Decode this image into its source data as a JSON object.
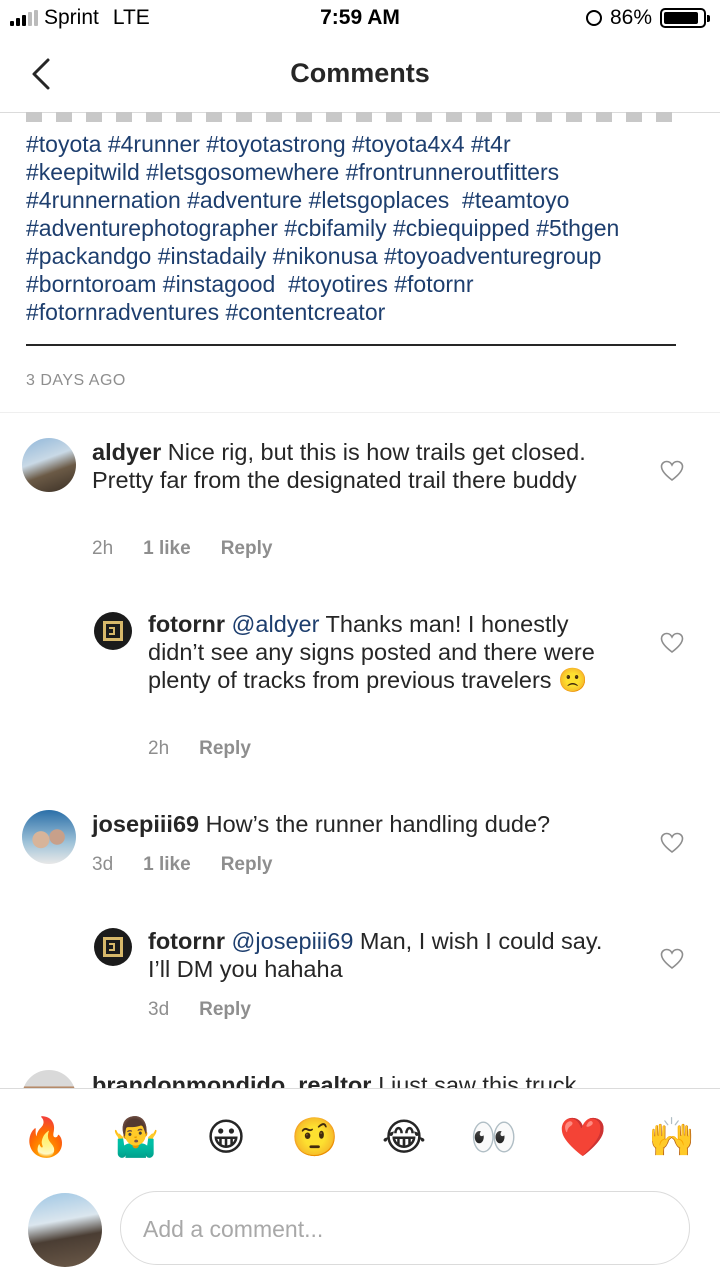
{
  "status_bar": {
    "carrier": "Sprint",
    "network": "LTE",
    "time": "7:59 AM",
    "battery": "86%"
  },
  "header": {
    "title": "Comments"
  },
  "caption": {
    "hashtags": "#toyota #4runner #toyotastrong #toyota4x4 #t4r\n#keepitwild #letsgosomewhere #frontrunneroutfitters\n#4runnernation #adventure #letsgoplaces  #teamtoyo\n#adventurephotographer #cbifamily #cbiequipped #5thgen\n#packandgo #instadaily #nikonusa #toyoadventuregroup\n#borntoroam #instagood  #toyotires #fotornr\n#fotornradventures #contentcreator",
    "posted": "3 DAYS AGO"
  },
  "comments": [
    {
      "user": "aldyer",
      "text": "Nice rig, but this is how trails get closed. Pretty far from the designated trail there buddy",
      "time": "2h",
      "likes": "1 like",
      "reply": "Reply"
    },
    {
      "user": "fotornr",
      "mention": "@aldyer",
      "text": "Thanks man! I honestly didn’t see any signs posted and there were plenty of tracks from previous travelers 🙁",
      "time": "2h",
      "reply": "Reply"
    },
    {
      "user": "josepiii69",
      "text": "How’s the runner handling dude?",
      "time": "3d",
      "likes": "1 like",
      "reply": "Reply"
    },
    {
      "user": "fotornr",
      "mention": "@josepiii69",
      "text": "Man, I wish I could say. I’ll DM you hahaha",
      "time": "3d",
      "reply": "Reply"
    },
    {
      "user": "brandonmondido_realtor",
      "text": "I just saw this truck"
    }
  ],
  "emoji_bar": [
    "🔥",
    "🤷‍♂️",
    "😀",
    "🤨",
    "😂",
    "👀",
    "❤️",
    "🙌"
  ],
  "composer": {
    "placeholder": "Add a comment..."
  },
  "colors": {
    "link": "#1d3e6e",
    "muted": "#8e8e8e",
    "text": "#262626"
  }
}
